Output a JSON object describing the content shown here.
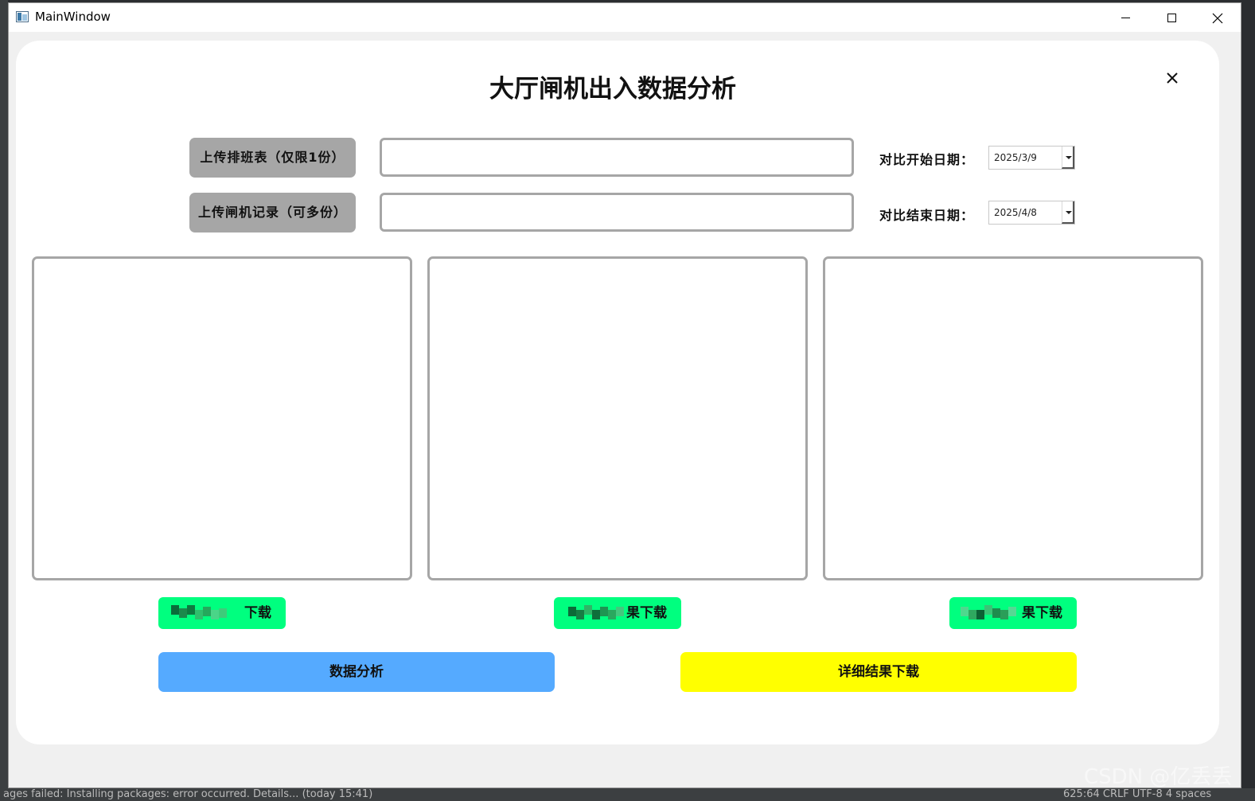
{
  "window": {
    "title": "MainWindow"
  },
  "header": {
    "title": "大厅闸机出入数据分析"
  },
  "uploads": {
    "schedule_label": "上传排班表（仅限1份）",
    "gate_label": "上传闸机记录（可多份）"
  },
  "dates": {
    "start_label": "对比开始日期：",
    "start_value": "2025/3/9",
    "end_label": "对比结束日期：",
    "end_value": "2025/4/8"
  },
  "downloads": {
    "left_visible": "下载",
    "middle_visible": "果下载",
    "right_visible": "果下载"
  },
  "actions": {
    "analyze_label": "数据分析",
    "detail_label": "详细结果下载"
  },
  "ide_status": {
    "left_text": "ages failed: Installing packages: error occurred. Details... (today 15:41)",
    "right_text": "625:64   CRLF   UTF-8   4 spaces"
  },
  "watermark": "CSDN @亿丢丢",
  "colors": {
    "upload_button": "#a6a6a6",
    "download_button": "#00ff7f",
    "analyze_button": "#55aaff",
    "detail_button": "#ffff00"
  }
}
